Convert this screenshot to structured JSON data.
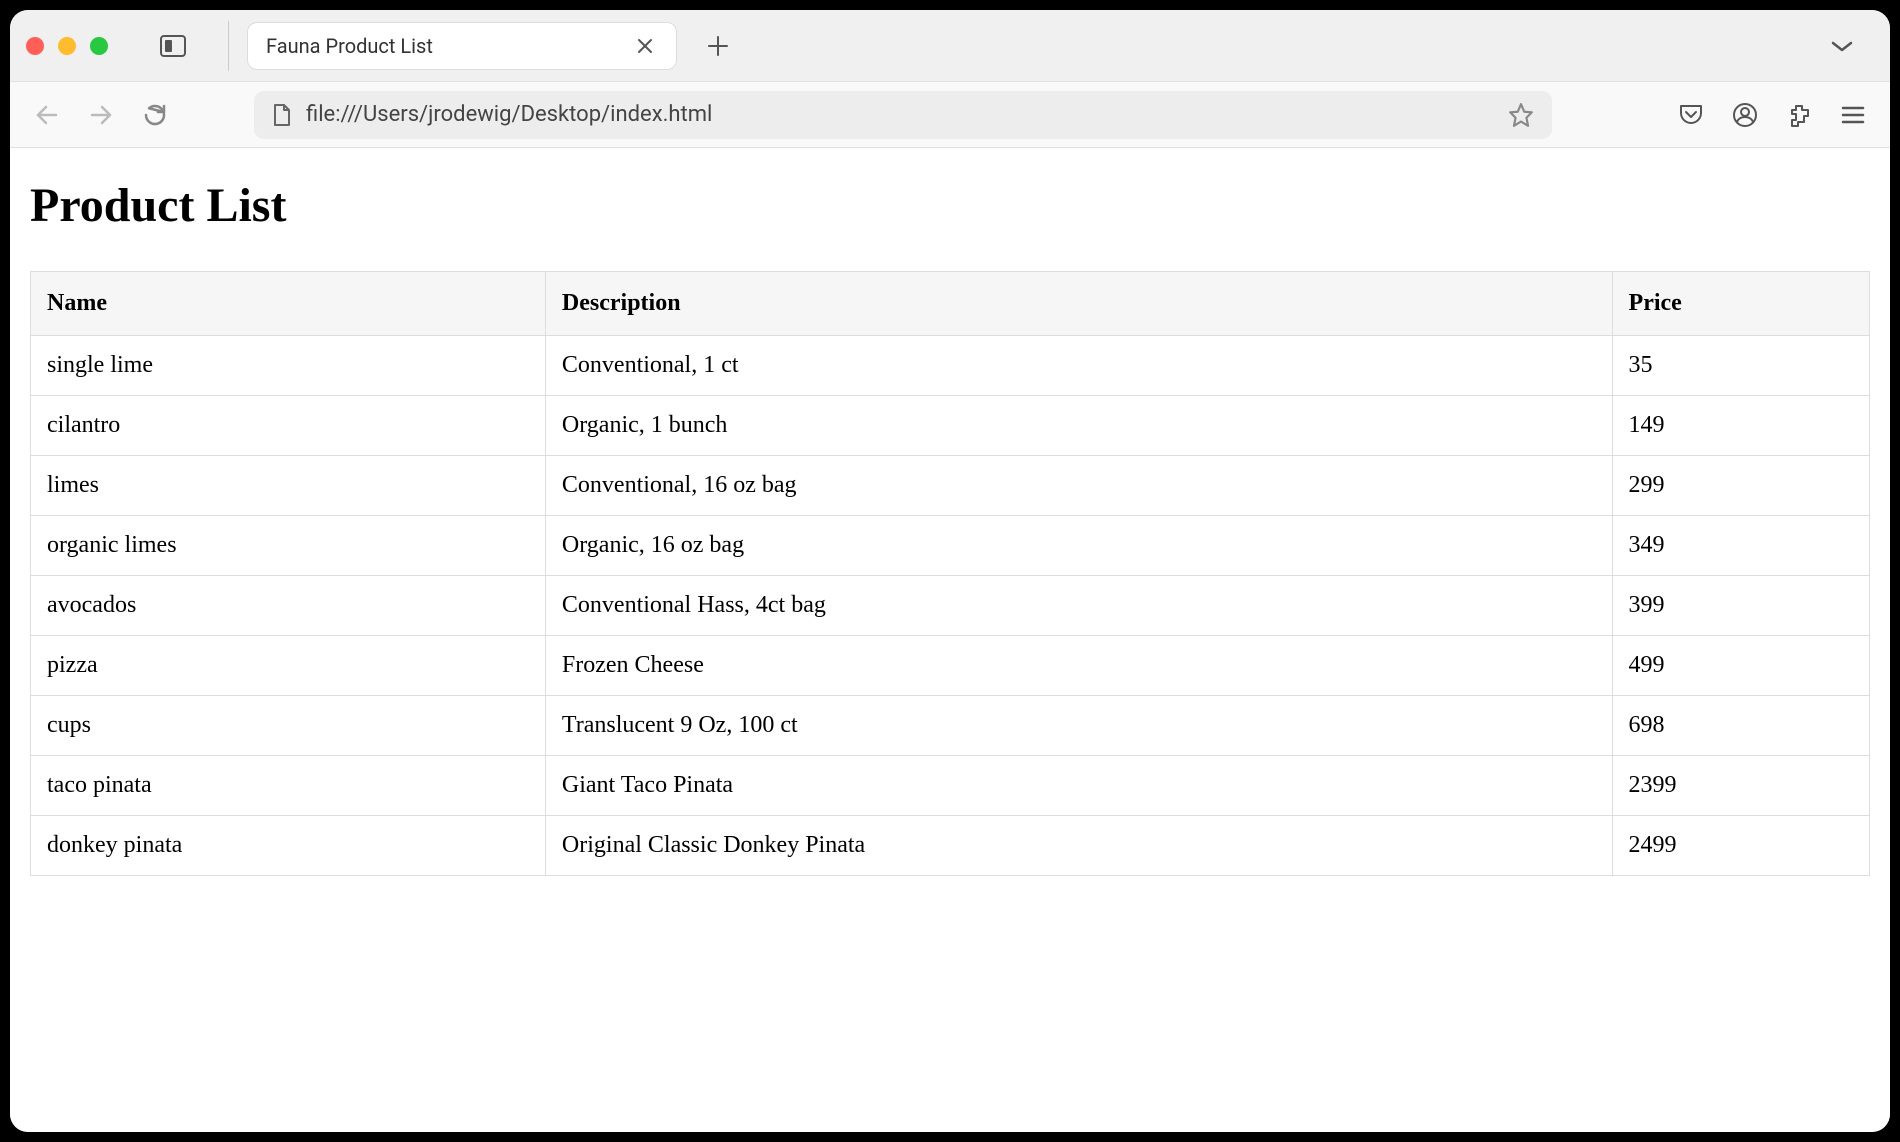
{
  "browser": {
    "tab_title": "Fauna Product List",
    "url": "file:///Users/jrodewig/Desktop/index.html"
  },
  "page": {
    "heading": "Product List",
    "table": {
      "headers": [
        "Name",
        "Description",
        "Price"
      ],
      "rows": [
        {
          "name": "single lime",
          "description": "Conventional, 1 ct",
          "price": "35"
        },
        {
          "name": "cilantro",
          "description": "Organic, 1 bunch",
          "price": "149"
        },
        {
          "name": "limes",
          "description": "Conventional, 16 oz bag",
          "price": "299"
        },
        {
          "name": "organic limes",
          "description": "Organic, 16 oz bag",
          "price": "349"
        },
        {
          "name": "avocados",
          "description": "Conventional Hass, 4ct bag",
          "price": "399"
        },
        {
          "name": "pizza",
          "description": "Frozen Cheese",
          "price": "499"
        },
        {
          "name": "cups",
          "description": "Translucent 9 Oz, 100 ct",
          "price": "698"
        },
        {
          "name": "taco pinata",
          "description": "Giant Taco Pinata",
          "price": "2399"
        },
        {
          "name": "donkey pinata",
          "description": "Original Classic Donkey Pinata",
          "price": "2499"
        }
      ]
    }
  }
}
